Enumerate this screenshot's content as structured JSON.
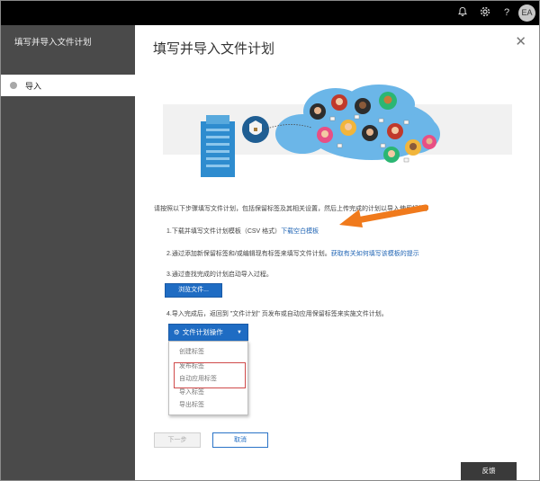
{
  "topbar": {
    "bell_icon": "bell-icon",
    "gear_icon": "gear-icon",
    "help": "?",
    "avatar": "EA"
  },
  "sidebar": {
    "title": "填写并导入文件计划",
    "steps": [
      {
        "label": "导入"
      }
    ]
  },
  "main": {
    "title": "填写并导入文件计划",
    "intro": "请按照以下步骤填写文件计划，包括保留标签及其相关设置，然后上传完成的计划以导入使用标签。",
    "step1_prefix": "1.下载并填写文件计划模板（CSV 格式）",
    "step1_link": "下载空白模板",
    "step2_prefix": "2.通过添加新保留标签和/或编辑现有标签来填写文件计划。",
    "step2_link": "获取有关如何填写该模板的提示",
    "step3": "3.通过查找完成的计划启动导入过程。",
    "browse_button": "浏览文件...",
    "step4": "4.导入完成后，返回到 \"文件计划\" 页发布或自动应用保留标签来实施文件计划。",
    "menu_button": "文件计划操作",
    "menu_items": [
      "创建标签",
      "发布标签",
      "自动应用标签",
      "导入标签",
      "导出标签"
    ],
    "next_button": "下一步",
    "cancel_button": "取消",
    "feedback_button": "反馈"
  },
  "colors": {
    "accent": "#1f6cc3",
    "sidebar_bg": "#4a4a4a",
    "arrow": "#f07a1c",
    "highlight_box": "#d04a4a"
  }
}
